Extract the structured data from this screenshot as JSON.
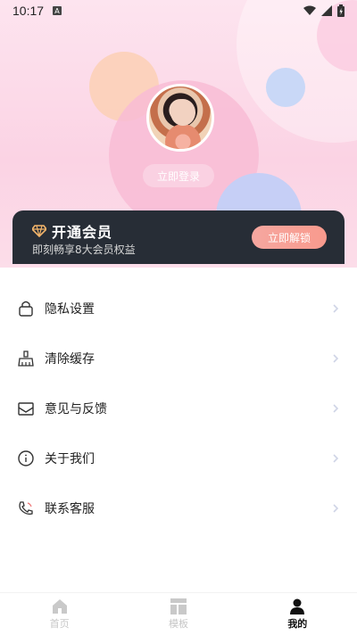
{
  "status_bar": {
    "time": "10:17",
    "notification_badge": "A",
    "icons": [
      "wifi-icon",
      "signal-icon",
      "battery-icon"
    ]
  },
  "profile": {
    "login_button": "立即登录"
  },
  "vip": {
    "title": "开通会员",
    "subtitle": "即刻畅享8大会员权益",
    "unlock_button": "立即解锁",
    "accent": "#f8a09a"
  },
  "menu": {
    "items": [
      {
        "label": "隐私设置",
        "icon": "lock-icon"
      },
      {
        "label": "清除缓存",
        "icon": "broom-icon"
      },
      {
        "label": "意见与反馈",
        "icon": "mail-icon"
      },
      {
        "label": "关于我们",
        "icon": "info-icon"
      },
      {
        "label": "联系客服",
        "icon": "phone-icon"
      }
    ]
  },
  "tabbar": {
    "tabs": [
      {
        "label": "首页",
        "icon": "home-icon",
        "active": false
      },
      {
        "label": "模板",
        "icon": "template-icon",
        "active": false
      },
      {
        "label": "我的",
        "icon": "user-icon",
        "active": true
      }
    ]
  }
}
